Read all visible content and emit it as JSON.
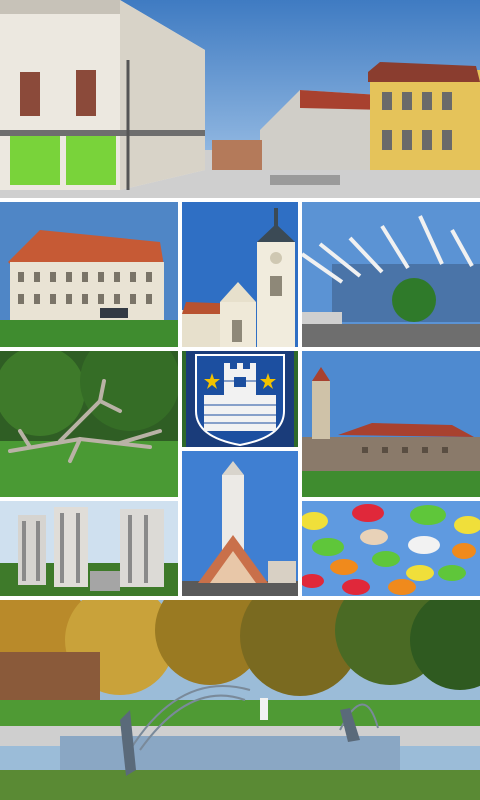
{
  "collage": {
    "panels": [
      {
        "id": "town-square"
      },
      {
        "id": "baroque-palace"
      },
      {
        "id": "church-tower"
      },
      {
        "id": "modern-arena"
      },
      {
        "id": "driftwood-sculpture"
      },
      {
        "id": "coat-of-arms"
      },
      {
        "id": "old-fortress"
      },
      {
        "id": "apartment-blocks"
      },
      {
        "id": "modern-church"
      },
      {
        "id": "umbrella-street"
      },
      {
        "id": "park-fountain"
      }
    ],
    "colors": {
      "sky": "#4f86c6",
      "grass": "#3f8c2f",
      "shield_blue": "#1c4fa0",
      "stars": "#f2c200"
    }
  }
}
